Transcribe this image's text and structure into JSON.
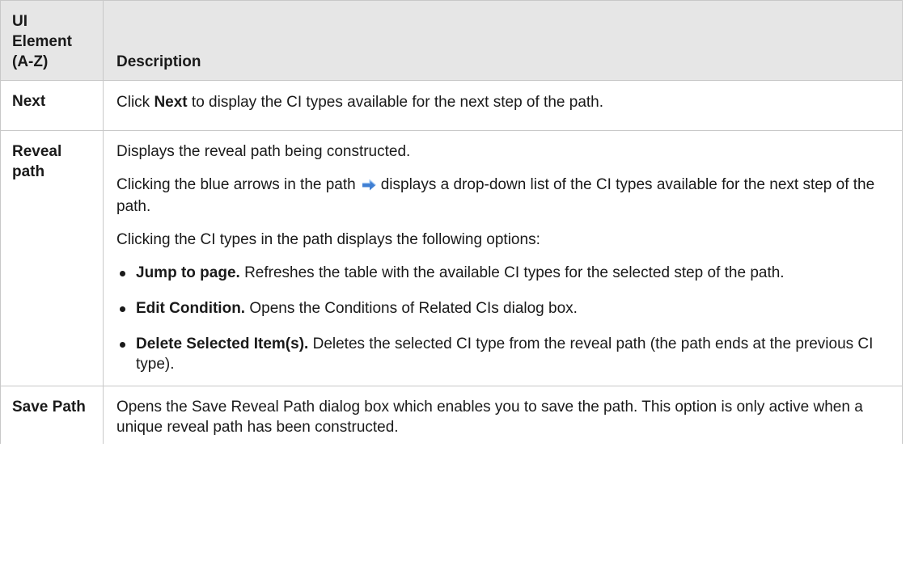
{
  "header": {
    "col1": "UI Element (A-Z)",
    "col2": "Description"
  },
  "rows": {
    "next": {
      "name": "Next",
      "desc_pre": "Click ",
      "desc_bold": "Next",
      "desc_post": " to display the CI types available for the next step of the path."
    },
    "reveal": {
      "name": "Reveal path",
      "p1": "Displays the reveal path being constructed.",
      "p2_pre": "Clicking the blue arrows in the path",
      "p2_post": "displays a drop-down list of the CI types available for the next step of the path.",
      "arrow_icon": "blue-right-arrow-icon",
      "p3": "Clicking the CI types in the path displays the following options:",
      "options": [
        {
          "bold": "Jump to page.",
          "text": " Refreshes the table with the available CI types for the selected step of the path."
        },
        {
          "bold": "Edit Condition.",
          "text": " Opens the Conditions of Related CIs dialog box."
        },
        {
          "bold": "Delete Selected Item(s).",
          "text": " Deletes the selected CI type from the reveal path (the path ends at the previous CI type)."
        }
      ]
    },
    "save": {
      "name": "Save Path",
      "desc": "Opens the Save Reveal Path dialog box which enables you to save the path. This option is only active when a unique reveal path has been constructed."
    }
  },
  "colors": {
    "header_bg": "#e6e6e6",
    "border": "#c8c8c8",
    "arrow": "#3f7fd3"
  }
}
